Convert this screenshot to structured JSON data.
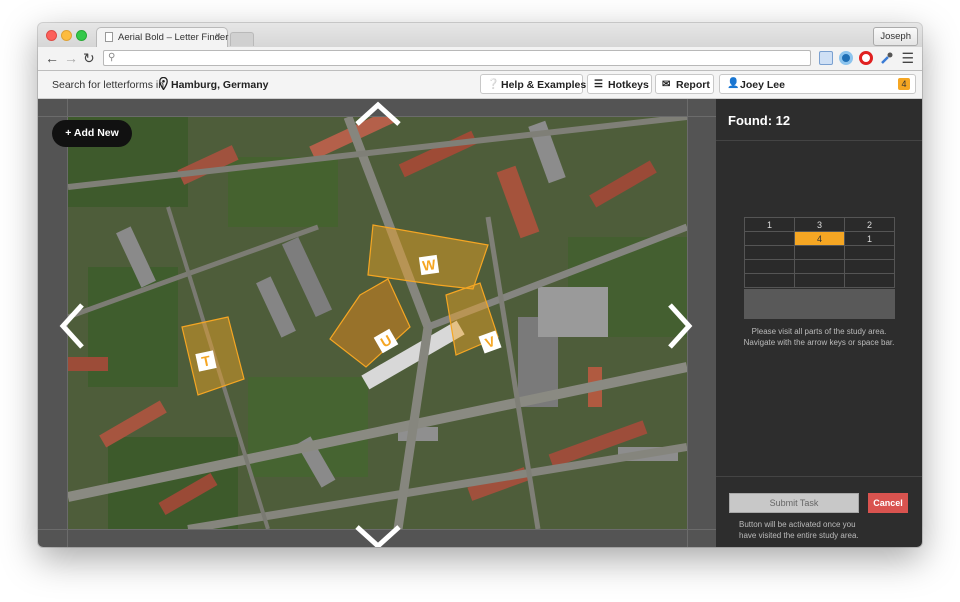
{
  "browser": {
    "tab_title": "Aerial Bold – Letter Finder",
    "tab_close": "×",
    "profile_name": "Joseph"
  },
  "header": {
    "search_prefix": "Search for letterforms in",
    "location": "Hamburg, Germany",
    "help_label": "Help & Examples",
    "hotkeys_label": "Hotkeys",
    "report_label": "Report",
    "user_name": "Joey Lee",
    "user_badge": "4"
  },
  "map": {
    "add_new_label": "+ Add New",
    "letters": [
      "W",
      "U",
      "V",
      "T"
    ],
    "highlight_color": "#f5a623"
  },
  "sidebar": {
    "found_label": "Found: 12",
    "tracker_rows": [
      [
        "1",
        "3",
        "2"
      ],
      [
        "",
        "4",
        "1"
      ],
      [
        "",
        "",
        ""
      ],
      [
        "",
        "",
        ""
      ],
      [
        "",
        "",
        ""
      ]
    ],
    "instructions_line1": "Please visit all parts of the study area.",
    "instructions_line2": "Navigate with the arrow keys or space bar.",
    "submit_label": "Submit Task",
    "cancel_label": "Cancel",
    "submit_note": "Button will be activated once you have visited the entire study area."
  },
  "colors": {
    "accent": "#f5a623",
    "cancel": "#d9534f",
    "sidebar_bg": "#2d2d2d"
  }
}
